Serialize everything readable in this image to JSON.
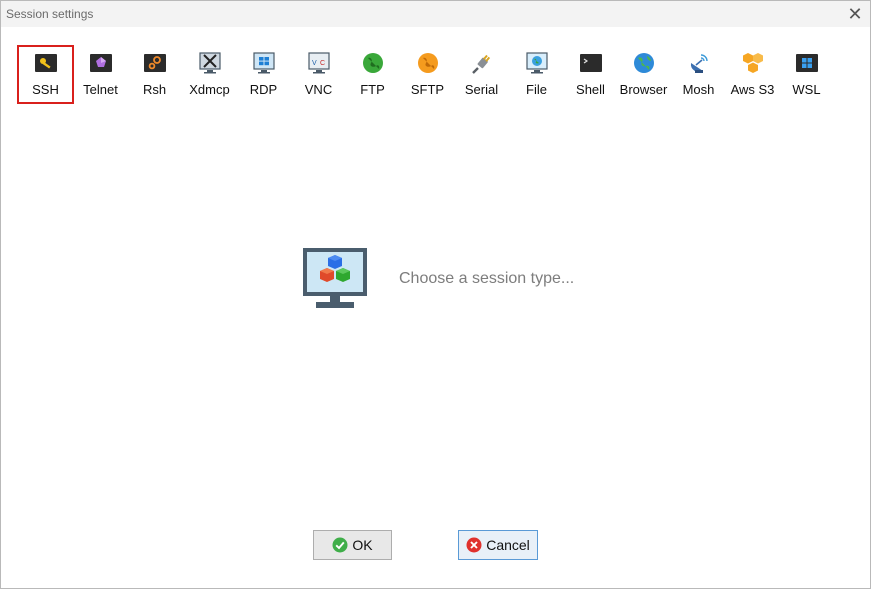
{
  "window": {
    "title": "Session settings"
  },
  "session_types": [
    {
      "label": "SSH",
      "icon": "ssh-icon",
      "selected": true
    },
    {
      "label": "Telnet",
      "icon": "telnet-icon"
    },
    {
      "label": "Rsh",
      "icon": "rsh-icon"
    },
    {
      "label": "Xdmcp",
      "icon": "xdmcp-icon"
    },
    {
      "label": "RDP",
      "icon": "rdp-icon"
    },
    {
      "label": "VNC",
      "icon": "vnc-icon"
    },
    {
      "label": "FTP",
      "icon": "ftp-icon"
    },
    {
      "label": "SFTP",
      "icon": "sftp-icon"
    },
    {
      "label": "Serial",
      "icon": "serial-icon"
    },
    {
      "label": "File",
      "icon": "file-icon"
    },
    {
      "label": "Shell",
      "icon": "shell-icon"
    },
    {
      "label": "Browser",
      "icon": "browser-icon"
    },
    {
      "label": "Mosh",
      "icon": "mosh-icon"
    },
    {
      "label": "Aws S3",
      "icon": "aws-s3-icon"
    },
    {
      "label": "WSL",
      "icon": "wsl-icon"
    }
  ],
  "main": {
    "prompt": "Choose a session type..."
  },
  "buttons": {
    "ok_label": "OK",
    "cancel_label": "Cancel"
  },
  "colors": {
    "selection_border": "#d9201c",
    "ok_icon": "#3fae49",
    "cancel_icon": "#e0312d"
  }
}
